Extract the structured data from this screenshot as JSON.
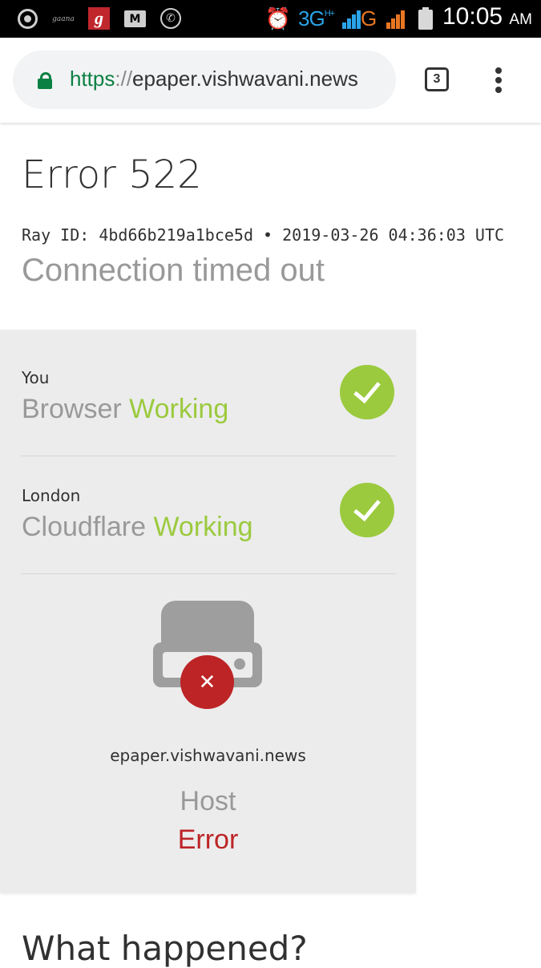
{
  "status_bar": {
    "gaana_label": "gaana",
    "g_label": "g",
    "mail_label": "M",
    "network_3g": "3G",
    "network_3g_sup": "H+",
    "network_g": "G",
    "time": "10:05",
    "ampm": "AM",
    "icons": [
      "chrome-icon",
      "gaana-icon",
      "g-app-icon",
      "gmail-icon",
      "phone-icon",
      "alarm-icon",
      "signal-icon",
      "battery-icon"
    ]
  },
  "browser": {
    "url_scheme": "https",
    "url_sep": "://",
    "url_host": "epaper.vishwavani.news",
    "tab_count": "3",
    "colors": {
      "secure": "#0b8043"
    }
  },
  "page": {
    "title": "Error 522",
    "ray_line": "Ray ID: 4bd66b219a1bce5d • 2019-03-26 04:36:03 UTC",
    "subtitle": "Connection timed out",
    "diagnostics": [
      {
        "location": "You",
        "name": "Browser",
        "status": "Working"
      },
      {
        "location": "London",
        "name": "Cloudflare",
        "status": "Working"
      }
    ],
    "host": {
      "domain": "epaper.vishwavani.news",
      "name": "Host",
      "status": "Error"
    },
    "what_happened": "What happened?",
    "colors": {
      "working": "#9bca3e",
      "error": "#bd2426"
    }
  }
}
